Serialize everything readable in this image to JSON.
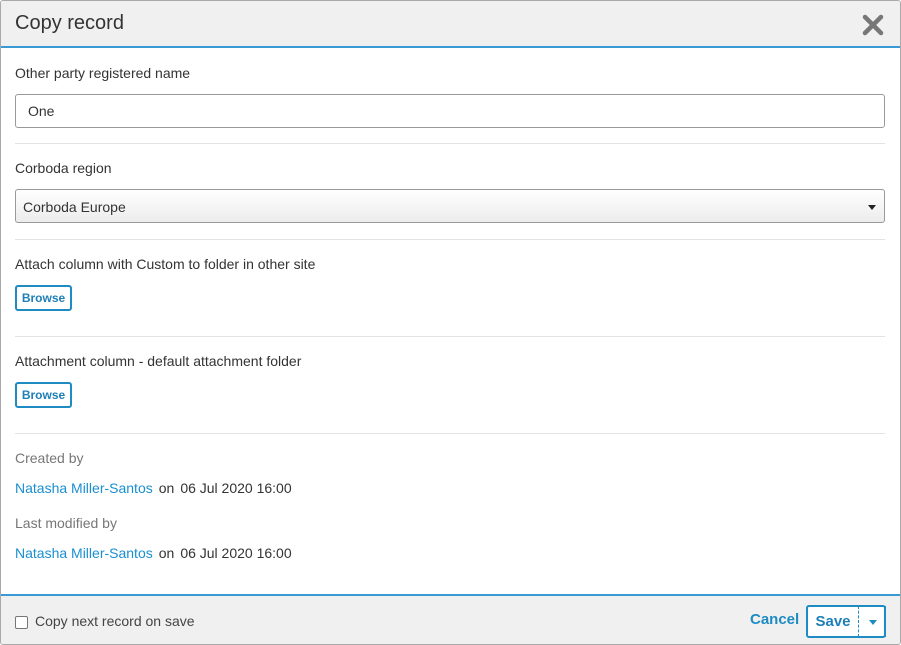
{
  "dialog": {
    "title": "Copy record",
    "close_icon": "close-x-icon"
  },
  "fields": {
    "other_party": {
      "label": "Other party registered name",
      "value": "One"
    },
    "region": {
      "label": "Corboda region",
      "selected": "Corboda Europe"
    },
    "attach_custom": {
      "label": "Attach column with Custom to folder in other site",
      "button": "Browse"
    },
    "attach_default": {
      "label": "Attachment column - default attachment folder",
      "button": "Browse"
    }
  },
  "meta": {
    "created_label": "Created by",
    "created_user": "Natasha Miller-Santos",
    "created_on": "on",
    "created_date": "06 Jul 2020 16:00",
    "modified_label": "Last modified by",
    "modified_user": "Natasha Miller-Santos",
    "modified_on": "on",
    "modified_date": "06 Jul 2020 16:00"
  },
  "footer": {
    "copy_next_label": "Copy next record on save",
    "copy_next_checked": false,
    "cancel": "Cancel",
    "save": "Save"
  },
  "colors": {
    "accent": "#1e8bc3",
    "header_bg": "#f0f0f0",
    "link": "#1a8fd0"
  }
}
